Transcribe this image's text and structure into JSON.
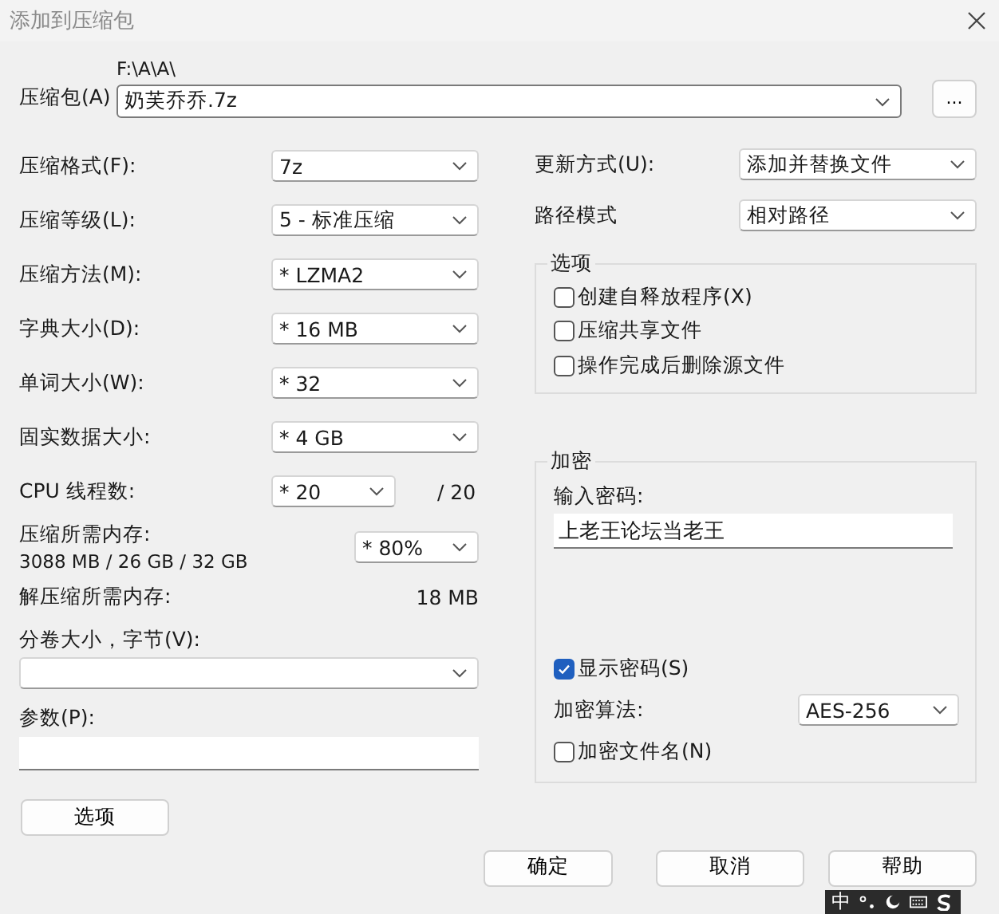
{
  "window": {
    "title": "添加到压缩包"
  },
  "archive": {
    "label": "压缩包(A)",
    "path": "F:\\A\\A\\",
    "value": "奶芙乔乔.7z",
    "browse": "..."
  },
  "settings": [
    {
      "kind": "combo",
      "label": "压缩格式(F):",
      "value": "7z"
    },
    {
      "kind": "combo",
      "label": "压缩等级(L):",
      "value": "5 - 标准压缩"
    },
    {
      "kind": "combo",
      "label": "压缩方法(M):",
      "value": "*  LZMA2"
    },
    {
      "kind": "combo",
      "label": "字典大小(D):",
      "value": "*  16 MB"
    },
    {
      "kind": "combo",
      "label": "单词大小(W):",
      "value": "*  32"
    },
    {
      "kind": "combo",
      "label": "固实数据大小:",
      "value": "*  4 GB"
    },
    {
      "kind": "threads",
      "label": "CPU 线程数:",
      "value": "*  20",
      "suffix": "/ 20"
    },
    {
      "kind": "memory",
      "label": "压缩所需内存:",
      "detail": "3088 MB / 26 GB / 32 GB",
      "value": "* 80%"
    },
    {
      "kind": "readout",
      "label": "解压缩所需内存:",
      "value": "18 MB"
    }
  ],
  "volume": {
    "label": "分卷大小，字节(V):"
  },
  "parameters": {
    "label": "参数(P):"
  },
  "options_button": "选项",
  "update_mode": {
    "label": "更新方式(U):",
    "value": "添加并替换文件"
  },
  "path_mode": {
    "label": "路径模式",
    "value": "相对路径"
  },
  "options": {
    "title": "选项",
    "checkboxes": [
      {
        "label": "创建自释放程序(X)",
        "checked": false
      },
      {
        "label": "压缩共享文件",
        "checked": false
      },
      {
        "label": "操作完成后删除源文件",
        "checked": false
      }
    ]
  },
  "encryption": {
    "title": "加密",
    "password_label": "输入密码:",
    "password": "上老王论坛当老王",
    "show_password": {
      "label": "显示密码(S)",
      "checked": true
    },
    "method_label": "加密算法:",
    "method": "AES-256",
    "encrypt_names": {
      "label": "加密文件名(N)",
      "checked": false
    }
  },
  "buttons": [
    "确定",
    "取消",
    "帮助"
  ],
  "ime_bar": {
    "mode": "中"
  }
}
